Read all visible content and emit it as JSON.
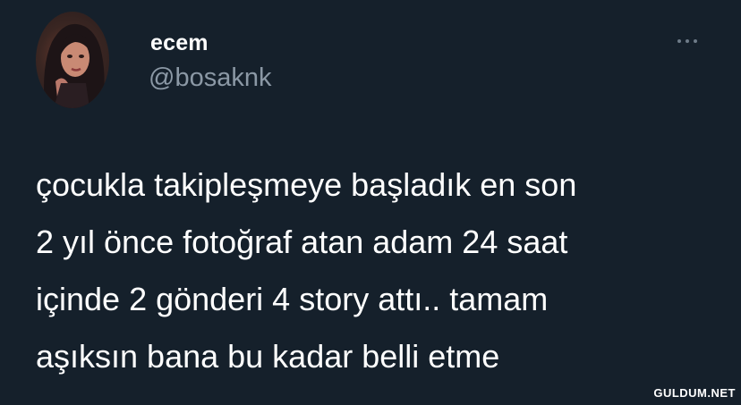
{
  "tweet": {
    "author": {
      "display_name": "ecem",
      "handle": "@bosaknk",
      "avatar_icon": "profile-photo"
    },
    "more_icon": "more-horizontal-icon",
    "text": "çocukla takipleşmeye başladık en son\n2 yıl önce fotoğraf atan adam 24 saat\niçinde 2 gönderi 4 story attı.. tamam\naşıksın bana bu kadar belli etme"
  },
  "watermark": "GULDUM.NET",
  "colors": {
    "background": "#15202b",
    "text": "#ffffff",
    "secondary": "#8b98a5"
  }
}
